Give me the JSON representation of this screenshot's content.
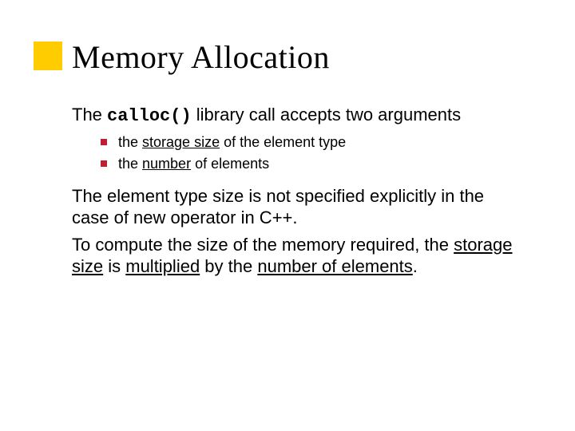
{
  "title": "Memory Allocation",
  "intro": {
    "pre": "The ",
    "code": "calloc()",
    "post": " library call accepts two arguments"
  },
  "bullets": [
    {
      "pre": "the ",
      "u": "storage size",
      "post": " of the element type"
    },
    {
      "pre": "the ",
      "u": "number",
      "post": " of elements"
    }
  ],
  "para2": "The element type size is not specified explicitly in the case of new operator in C++.",
  "para3": {
    "t1": "To compute the size of the memory required, the ",
    "u1": "storage size",
    "t2": " is ",
    "u2": "multiplied",
    "t3": " by the ",
    "u3": "number of elements",
    "t4": "."
  }
}
